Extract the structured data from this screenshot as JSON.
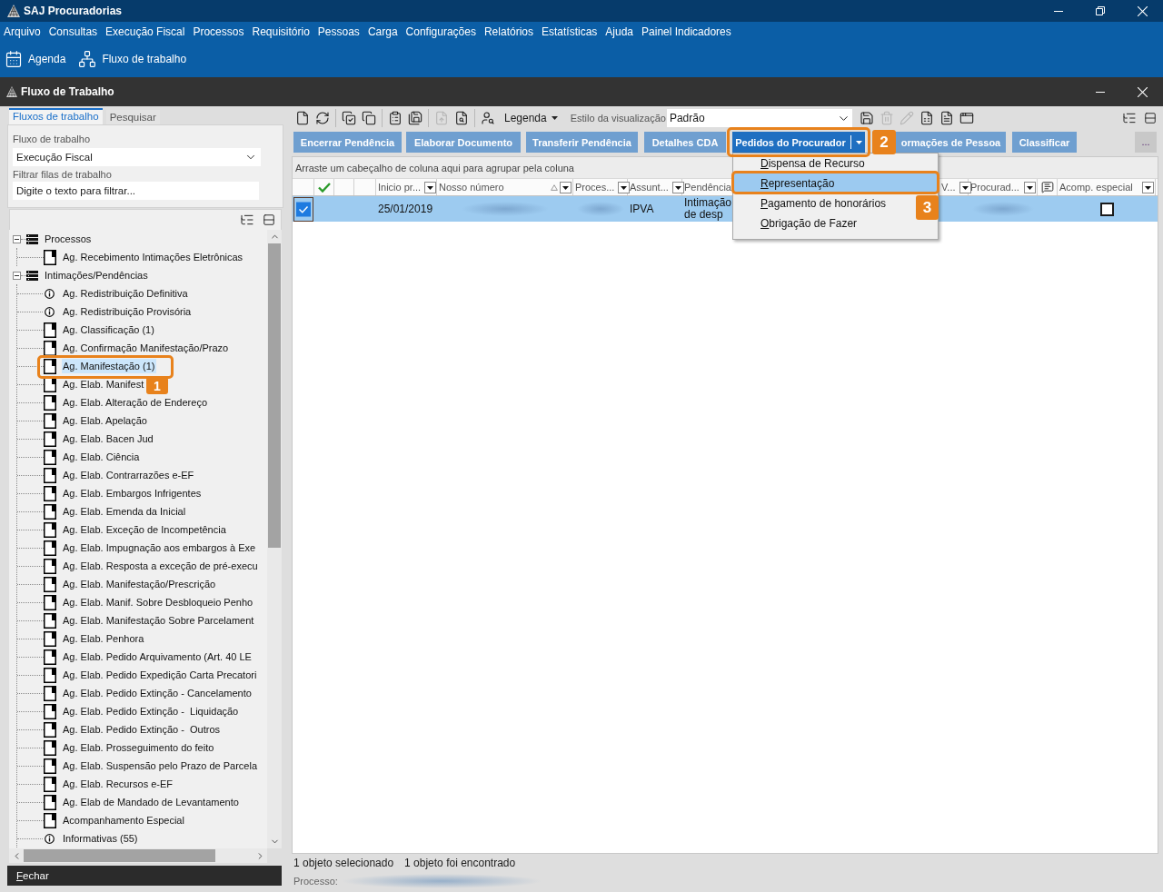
{
  "window": {
    "title": "SAJ Procuradorias"
  },
  "menu_bar": [
    "Arquivo",
    "Consultas",
    "Execução Fiscal",
    "Processos",
    "Requisitório",
    "Pessoas",
    "Carga",
    "Configurações",
    "Relatórios",
    "Estatísticas",
    "Ajuda",
    "Painel Indicadores"
  ],
  "toolbar": [
    {
      "label": "Agenda",
      "kind": "calendar"
    },
    {
      "label": "Fluxo de trabalho",
      "kind": "sitemap"
    }
  ],
  "child_window": {
    "title": "Fluxo de Trabalho"
  },
  "left_panel": {
    "tabs": [
      {
        "label": "Fluxos de trabalho",
        "selected": true
      },
      {
        "label": "Pesquisar",
        "selected": false
      }
    ],
    "workflow": {
      "label": "Fluxo de trabalho",
      "value": "Execução Fiscal"
    },
    "filter": {
      "label": "Filtrar filas de trabalho",
      "placeholder": "Digite o texto para filtrar..."
    },
    "tree": [
      {
        "label": "Processos",
        "kind": "group",
        "expanded": true,
        "selected": false,
        "children": [
          {
            "label": "Ag. Recebimento Intimações Eletrônicas",
            "kind": "queue",
            "selected": false
          }
        ]
      },
      {
        "label": "Intimações/Pendências",
        "kind": "group",
        "expanded": true,
        "selected": false,
        "children": [
          {
            "label": "Ag. Redistribuição Definitiva",
            "kind": "info",
            "selected": false
          },
          {
            "label": "Ag. Redistribuição Provisória",
            "kind": "info",
            "selected": false
          },
          {
            "label": "Ag. Classificação (1)",
            "kind": "queue",
            "selected": false
          },
          {
            "label": "Ag. Confirmação Manifestação/Prazo",
            "kind": "queue",
            "selected": false
          },
          {
            "label": "Ag. Manifestação (1)",
            "kind": "queue",
            "selected": true
          },
          {
            "label": "Ag. Elab. Manifest",
            "kind": "queue",
            "selected": false
          },
          {
            "label": "Ag. Elab. Alteração de Endereço",
            "kind": "queue",
            "selected": false
          },
          {
            "label": "Ag. Elab. Apelação",
            "kind": "queue",
            "selected": false
          },
          {
            "label": "Ag. Elab. Bacen Jud",
            "kind": "queue",
            "selected": false
          },
          {
            "label": "Ag. Elab. Ciência",
            "kind": "queue",
            "selected": false
          },
          {
            "label": "Ag. Elab. Contrarrazões e-EF",
            "kind": "queue",
            "selected": false
          },
          {
            "label": "Ag. Elab. Embargos Infrigentes",
            "kind": "queue",
            "selected": false
          },
          {
            "label": "Ag. Elab. Emenda da Inicial",
            "kind": "queue",
            "selected": false
          },
          {
            "label": "Ag. Elab. Exceção de Incompetência",
            "kind": "queue",
            "selected": false
          },
          {
            "label": "Ag. Elab. Impugnação aos embargos à Exe",
            "kind": "queue",
            "selected": false
          },
          {
            "label": "Ag. Elab. Resposta a exceção de pré-execu",
            "kind": "queue",
            "selected": false
          },
          {
            "label": "Ag. Elab. Manifestação/Prescrição",
            "kind": "queue",
            "selected": false
          },
          {
            "label": "Ag. Elab. Manif. Sobre Desbloqueio Penho",
            "kind": "queue",
            "selected": false
          },
          {
            "label": "Ag. Elab. Manifestação Sobre Parcelament",
            "kind": "queue",
            "selected": false
          },
          {
            "label": "Ag. Elab. Penhora",
            "kind": "queue",
            "selected": false
          },
          {
            "label": "Ag. Elab. Pedido Arquivamento (Art. 40 LE",
            "kind": "queue",
            "selected": false
          },
          {
            "label": "Ag. Elab. Pedido Expedição Carta Precatori",
            "kind": "queue",
            "selected": false
          },
          {
            "label": "Ag. Elab. Pedido Extinção - Cancelamento",
            "kind": "queue",
            "selected": false
          },
          {
            "label": "Ag. Elab. Pedido Extinção -  Liquidação",
            "kind": "queue",
            "selected": false
          },
          {
            "label": "Ag. Elab. Pedido Extinção -  Outros",
            "kind": "queue",
            "selected": false
          },
          {
            "label": "Ag. Elab. Prosseguimento do feito",
            "kind": "queue",
            "selected": false
          },
          {
            "label": "Ag. Elab. Suspensão pelo Prazo de Parcela",
            "kind": "queue",
            "selected": false
          },
          {
            "label": "Ag. Elab. Recursos e-EF",
            "kind": "queue",
            "selected": false
          },
          {
            "label": "Ag. Elab de Mandado de Levantamento",
            "kind": "queue",
            "selected": false
          },
          {
            "label": "Acompanhamento Especial",
            "kind": "queue",
            "selected": false
          },
          {
            "label": "Informativas (55)",
            "kind": "info",
            "selected": false
          }
        ]
      }
    ],
    "close_button": "Fechar"
  },
  "right_panel": {
    "tools": [
      {
        "kind": "new",
        "disabled": false
      },
      {
        "kind": "refresh",
        "disabled": false
      },
      {
        "kind": "separator"
      },
      {
        "kind": "select_all",
        "disabled": false
      },
      {
        "kind": "windows",
        "disabled": false
      },
      {
        "kind": "separator"
      },
      {
        "kind": "clipboard",
        "disabled": false
      },
      {
        "kind": "save_all",
        "disabled": false
      },
      {
        "kind": "separator"
      },
      {
        "kind": "export",
        "disabled": true
      },
      {
        "kind": "search",
        "disabled": false
      },
      {
        "kind": "separator"
      },
      {
        "kind": "users",
        "disabled": false
      }
    ],
    "legend": "Legenda",
    "view_style": {
      "label": "Estilo da visualização",
      "value": "Padrão"
    },
    "tools_right": [
      {
        "kind": "save",
        "disabled": false
      },
      {
        "kind": "trash",
        "disabled": true
      },
      {
        "kind": "edit",
        "disabled": true
      },
      {
        "kind": "spreadsheet",
        "disabled": false
      },
      {
        "kind": "document",
        "disabled": false
      },
      {
        "kind": "window",
        "disabled": false
      }
    ],
    "actions": [
      {
        "label": "Encerrar Pendência",
        "kind": "button",
        "active": false
      },
      {
        "label": "Elaborar Documento",
        "kind": "button",
        "active": false
      },
      {
        "label": "Transferir Pendência",
        "kind": "button",
        "active": false
      },
      {
        "label": "Detalhes CDA",
        "kind": "button",
        "active": false
      },
      {
        "label": "Pedidos do Procurador",
        "kind": "split",
        "active": true
      },
      {
        "label": "ormações de Pessoa",
        "kind": "button",
        "active": false
      },
      {
        "label": "Classificar",
        "kind": "button",
        "active": false
      }
    ],
    "more_button": "...",
    "menu": [
      {
        "label": "Dispensa de Recurso",
        "selected": false
      },
      {
        "label": "Representação",
        "selected": true
      },
      {
        "label": "Pagamento de honorários",
        "selected": false
      },
      {
        "label": "Obrigação de Fazer",
        "selected": false
      }
    ],
    "grid": {
      "group_hint": "Arraste um cabeçalho de coluna aqui para agrupar pela coluna",
      "columns": [
        {
          "kind": "select"
        },
        {
          "kind": "check"
        },
        {
          "kind": "blank"
        },
        {
          "kind": "blank"
        },
        {
          "kind": "text",
          "label": "Inicio pr...",
          "filter": true
        },
        {
          "kind": "text",
          "label": "Nosso número",
          "sorted": true,
          "filter": true
        },
        {
          "kind": "text",
          "label": "Proces...",
          "filter": true
        },
        {
          "kind": "text",
          "label": "Assunt...",
          "filter": true
        },
        {
          "kind": "text",
          "label": "Pendência"
        },
        {
          "kind": "text",
          "label": "V...",
          "filter": true
        },
        {
          "kind": "text",
          "label": "Procurad...",
          "filter": true
        },
        {
          "kind": "comment"
        },
        {
          "kind": "text",
          "label": "Acomp. especial",
          "filter": true
        }
      ],
      "rows": [
        {
          "selected": true,
          "cells": [
            {
              "kind": "checkbox",
              "checked": true
            },
            {
              "kind": "empty"
            },
            {
              "kind": "empty"
            },
            {
              "kind": "empty"
            },
            {
              "kind": "text",
              "text": "25/01/2019"
            },
            {
              "kind": "blurred"
            },
            {
              "kind": "blurred"
            },
            {
              "kind": "text",
              "text": "IPVA"
            },
            {
              "kind": "text",
              "text": "Intimação de desp"
            },
            {
              "kind": "empty"
            },
            {
              "kind": "blurred"
            },
            {
              "kind": "empty"
            },
            {
              "kind": "checkbox",
              "checked": false
            }
          ]
        }
      ]
    },
    "status": {
      "selection": "1 objeto selecionado",
      "found": "1 objeto foi encontrado",
      "process_label": "Processo:"
    }
  },
  "callouts": [
    {
      "label": "1"
    },
    {
      "label": "2"
    },
    {
      "label": "3"
    }
  ]
}
